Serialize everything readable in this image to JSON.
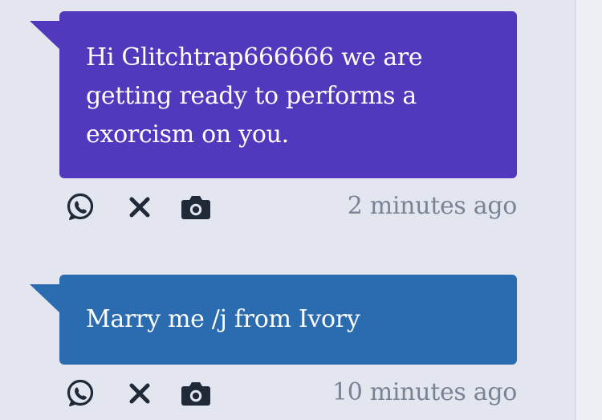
{
  "messages": [
    {
      "text": "Hi Glitchtrap666666 we are getting ready to performs a exorcism on you.",
      "timestamp": "2 minutes ago",
      "bubble_color": "#5238bd"
    },
    {
      "text": "Marry me /j from Ivory",
      "timestamp": "10 minutes ago",
      "bubble_color": "#2b6cb0"
    }
  ],
  "icons": {
    "share": "whatsapp-icon",
    "delete": "close-icon",
    "screenshot": "camera-icon",
    "icon_color": "#1f2937"
  },
  "colors": {
    "page_background": "#e3e6ef",
    "timestamp_text": "#7a8396"
  }
}
